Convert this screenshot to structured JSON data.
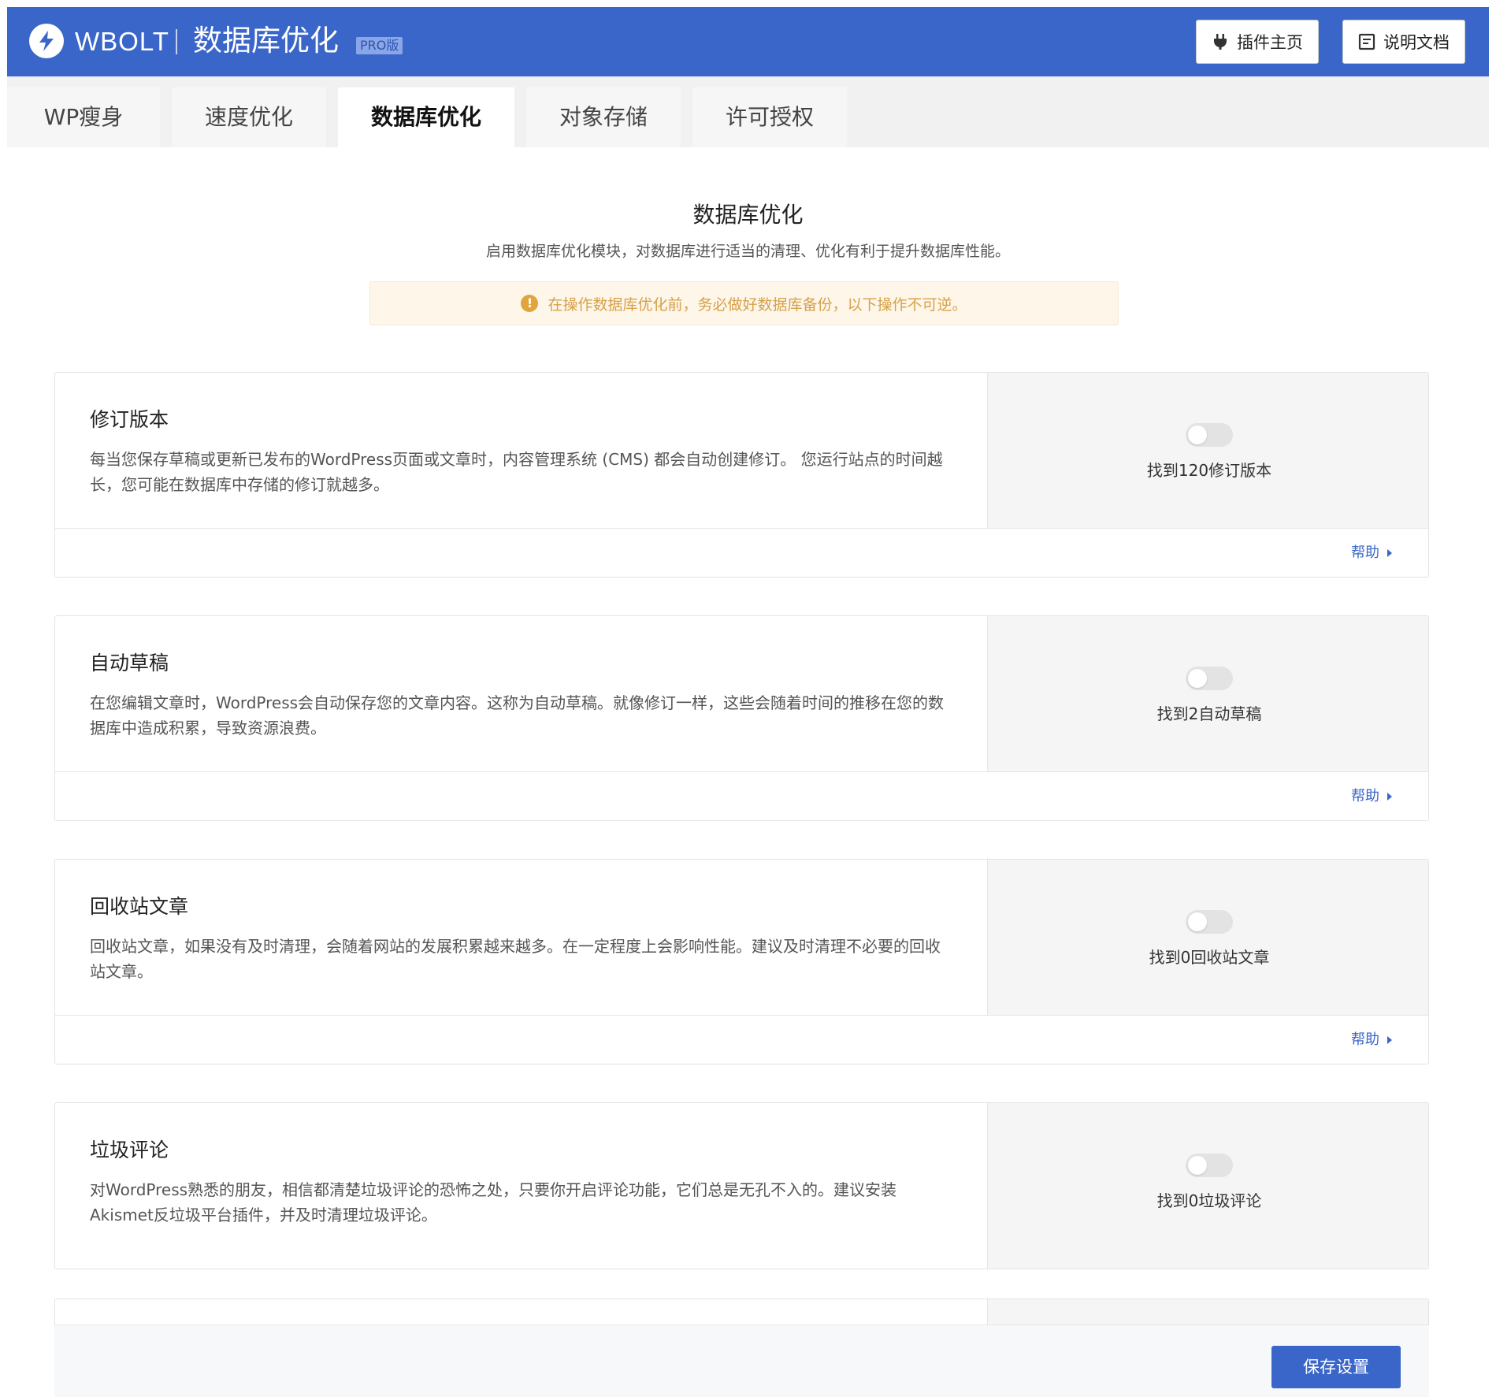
{
  "header": {
    "brand": "WBOLT",
    "page_heading": "数据库优化",
    "badge": "PRO版",
    "plugin_home": "插件主页",
    "docs": "说明文档",
    "accent_color": "#3a66c9"
  },
  "tabs": [
    {
      "label": "WP瘦身",
      "active": false
    },
    {
      "label": "速度优化",
      "active": false
    },
    {
      "label": "数据库优化",
      "active": true
    },
    {
      "label": "对象存储",
      "active": false
    },
    {
      "label": "许可授权",
      "active": false
    }
  ],
  "section": {
    "title": "数据库优化",
    "description": "启用数据库优化模块，对数据库进行适当的清理、优化有利于提升数据库性能。",
    "warning": "在操作数据库优化前，务必做好数据库备份，以下操作不可逆。",
    "warning_icon": "!"
  },
  "cards": [
    {
      "title": "修订版本",
      "description": "每当您保存草稿或更新已发布的WordPress页面或文章时，内容管理系统 (CMS) 都会自动创建修订。 您运行站点的时间越长，您可能在数据库中存储的修订就越多。",
      "count_text": "找到120修订版本",
      "enabled": false,
      "help": "帮助"
    },
    {
      "title": "自动草稿",
      "description": "在您编辑文章时，WordPress会自动保存您的文章内容。这称为自动草稿。就像修订一样，这些会随着时间的推移在您的数据库中造成积累，导致资源浪费。",
      "count_text": "找到2自动草稿",
      "enabled": false,
      "help": "帮助"
    },
    {
      "title": "回收站文章",
      "description": "回收站文章，如果没有及时清理，会随着网站的发展积累越来越多。在一定程度上会影响性能。建议及时清理不必要的回收站文章。",
      "count_text": "找到0回收站文章",
      "enabled": false,
      "help": "帮助"
    },
    {
      "title": "垃圾评论",
      "description": "对WordPress熟悉的朋友，相信都清楚垃圾评论的恐怖之处，只要你开启评论功能，它们总是无孔不入的。建议安装Akismet反垃圾平台插件，并及时清理垃圾评论。",
      "count_text": "找到0垃圾评论",
      "enabled": false
    }
  ],
  "footer": {
    "save_label": "保存设置"
  }
}
